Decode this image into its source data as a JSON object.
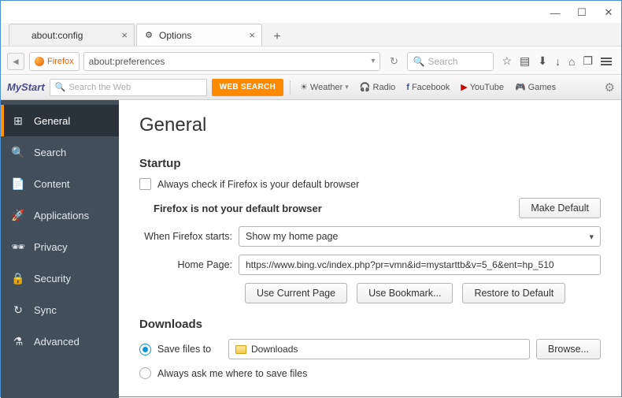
{
  "window": {
    "minimize": "—",
    "maximize": "☐",
    "close": "✕"
  },
  "tabs": [
    {
      "title": "about:config",
      "active": false
    },
    {
      "title": "Options",
      "active": true
    }
  ],
  "newtab_glyph": "+",
  "nav": {
    "back": "◄",
    "identity_label": "Firefox",
    "url": "about:preferences",
    "reload": "↻",
    "search_placeholder": "Search",
    "icons": {
      "star": "☆",
      "list": "▤",
      "pocket": "⬇",
      "download": "↓",
      "home": "⌂",
      "share": "❐"
    }
  },
  "mystart": {
    "logo": "MyStart",
    "search_placeholder": "Search the Web",
    "websearch": "WEB SEARCH",
    "links": {
      "weather": "Weather",
      "radio": "Radio",
      "facebook": "Facebook",
      "youtube": "YouTube",
      "games": "Games"
    }
  },
  "sidebar": {
    "items": [
      {
        "icon": "⊞",
        "label": "General"
      },
      {
        "icon": "🔍",
        "label": "Search"
      },
      {
        "icon": "📄",
        "label": "Content"
      },
      {
        "icon": "🚀",
        "label": "Applications"
      },
      {
        "icon": "🕶",
        "label": "Privacy"
      },
      {
        "icon": "🔒",
        "label": "Security"
      },
      {
        "icon": "↻",
        "label": "Sync"
      },
      {
        "icon": "⚗",
        "label": "Advanced"
      }
    ]
  },
  "main": {
    "heading": "General",
    "startup": {
      "heading": "Startup",
      "always_check": "Always check if Firefox is your default browser",
      "not_default": "Firefox is not your default browser",
      "make_default": "Make Default",
      "when_starts_label": "When Firefox starts:",
      "when_starts_value": "Show my home page",
      "homepage_label": "Home Page:",
      "homepage_value": "https://www.bing.vc/index.php?pr=vmn&id=mystarttb&v=5_6&ent=hp_510",
      "use_current": "Use Current Page",
      "use_bookmark": "Use Bookmark...",
      "restore_default": "Restore to Default"
    },
    "downloads": {
      "heading": "Downloads",
      "save_to_label": "Save files to",
      "save_to_value": "Downloads",
      "browse": "Browse...",
      "always_ask": "Always ask me where to save files"
    }
  }
}
